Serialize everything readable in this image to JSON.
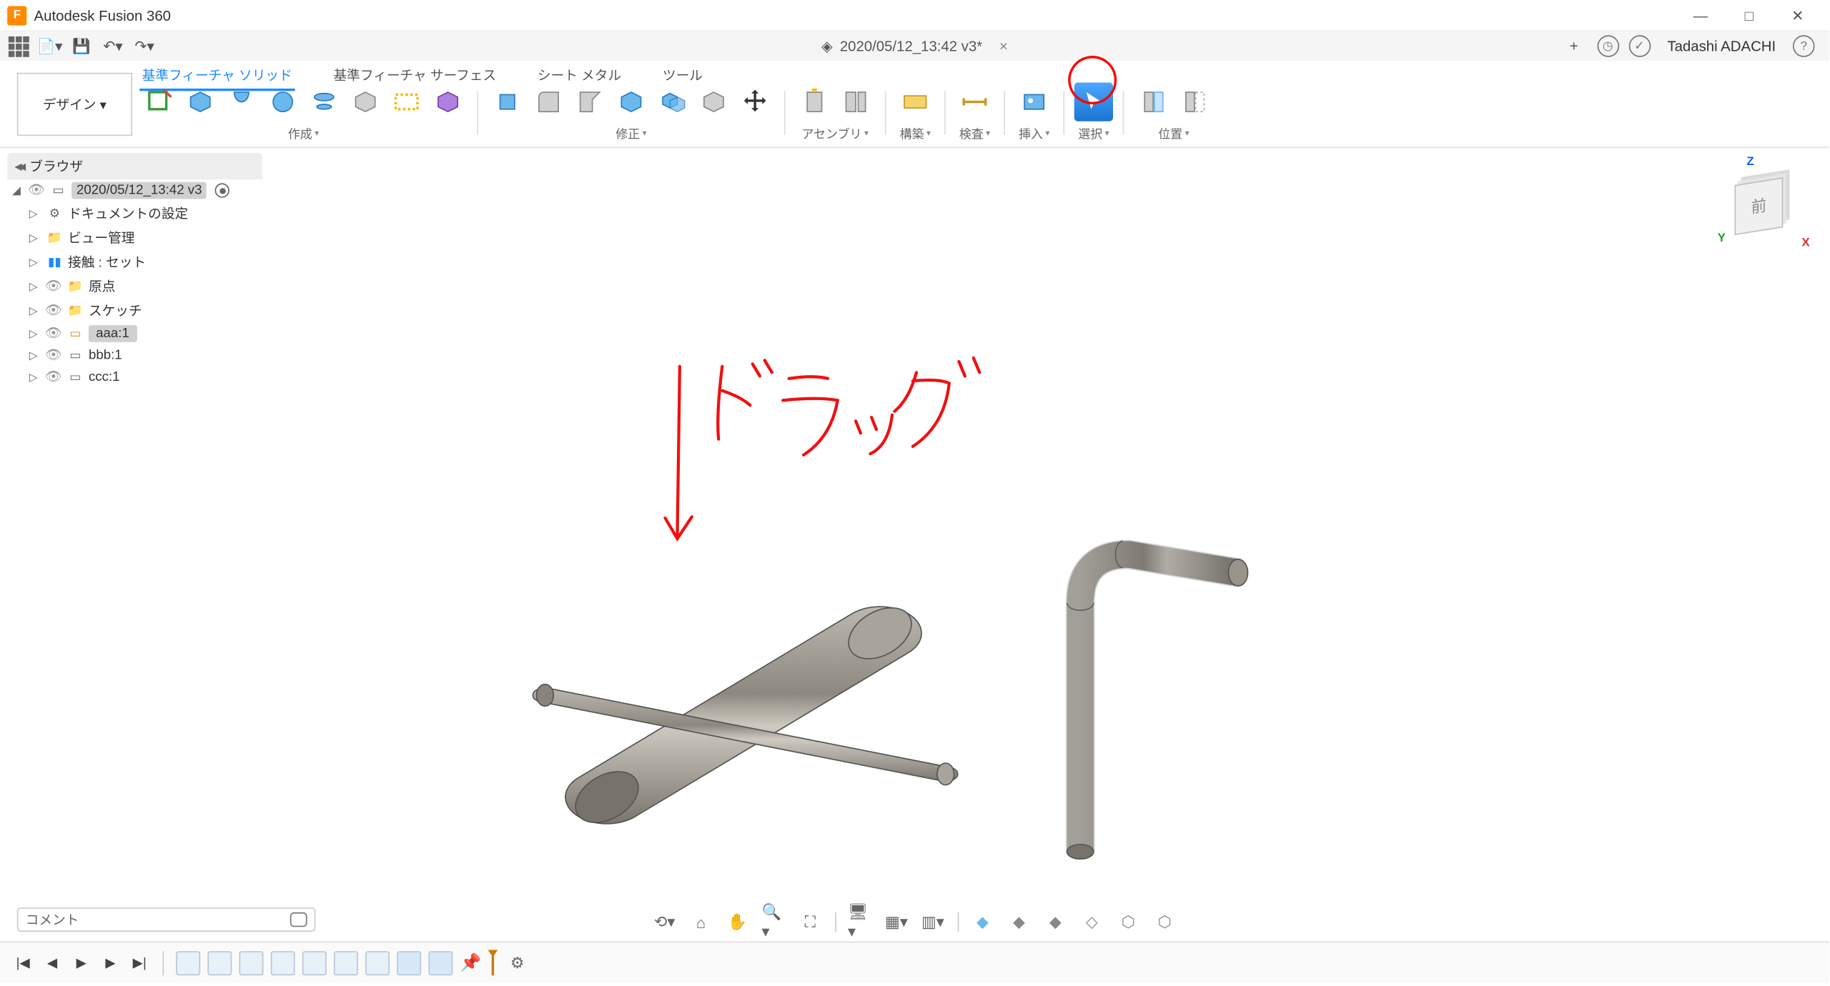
{
  "app": {
    "title": "Autodesk Fusion 360"
  },
  "window": {
    "min": "—",
    "max": "□",
    "close": "✕"
  },
  "qat": {
    "doc_title": "2020/05/12_13:42 v3*",
    "user": "Tadashi ADACHI",
    "plus": "+",
    "help": "?"
  },
  "ribbon": {
    "workspace": "デザイン ▾",
    "tabs": {
      "solid": "基準フィーチャ ソリッド",
      "surface": "基準フィーチャ サーフェス",
      "sheetmetal": "シート メタル",
      "tools": "ツール"
    },
    "groups": {
      "create": "作成",
      "modify": "修正",
      "assembly": "アセンブリ",
      "construct": "構築",
      "inspect": "検査",
      "insert": "挿入",
      "select": "選択",
      "position": "位置"
    }
  },
  "browser": {
    "title": "ブラウザ",
    "root": "2020/05/12_13:42 v3",
    "items": [
      {
        "label": "ドキュメントの設定",
        "icon": "gear"
      },
      {
        "label": "ビュー管理",
        "icon": "folder"
      },
      {
        "label": "接触 : セット",
        "icon": "contact"
      },
      {
        "label": "原点",
        "icon": "folder",
        "indent": true
      },
      {
        "label": "スケッチ",
        "icon": "folder",
        "indent": true
      },
      {
        "label": "aaa:1",
        "icon": "comp",
        "indent": true,
        "selected": true
      },
      {
        "label": "bbb:1",
        "icon": "comp",
        "indent": true
      },
      {
        "label": "ccc:1",
        "icon": "comp",
        "indent": true
      }
    ]
  },
  "viewcube": {
    "face": "前",
    "z": "Z",
    "x": "X",
    "y": "Y"
  },
  "annotation": {
    "text": "ドラッグ"
  },
  "comment": {
    "placeholder": "コメント"
  },
  "timeline": {
    "play_start": "|◀",
    "play_prev": "◀",
    "play": "▶",
    "play_next": "▶",
    "play_end": "▶|"
  }
}
